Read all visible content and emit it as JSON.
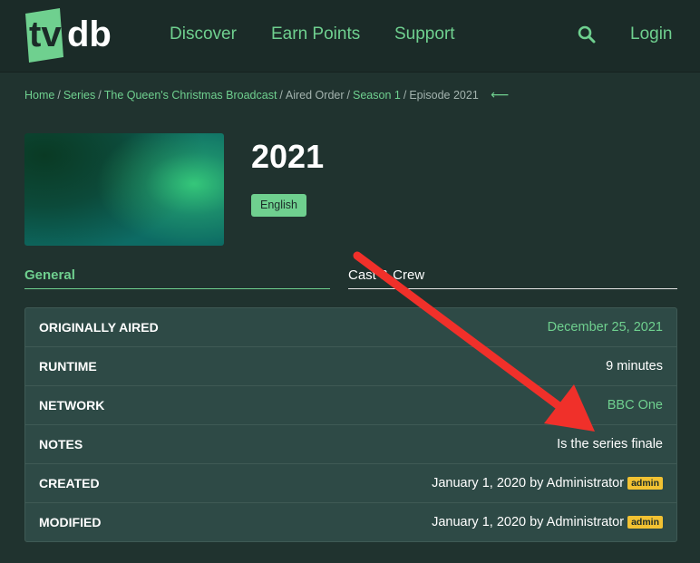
{
  "header": {
    "logo_text": "tvdb",
    "nav": [
      "Discover",
      "Earn Points",
      "Support"
    ],
    "search_icon": "search-icon",
    "login": "Login"
  },
  "breadcrumb": {
    "items": [
      {
        "label": "Home",
        "link": true
      },
      {
        "label": "Series",
        "link": true
      },
      {
        "label": "The Queen's Christmas Broadcast",
        "link": true
      },
      {
        "label": "Aired Order",
        "link": false
      },
      {
        "label": "Season 1",
        "link": true
      },
      {
        "label": "Episode 2021",
        "link": false
      }
    ],
    "separator": "/",
    "back_icon": "back-arrow-icon"
  },
  "episode": {
    "title": "2021",
    "language": "English"
  },
  "tabs": {
    "general": "General",
    "cast": "Cast & Crew"
  },
  "info": [
    {
      "label": "ORIGINALLY AIRED",
      "value": "December 25, 2021",
      "link": true
    },
    {
      "label": "RUNTIME",
      "value": "9 minutes",
      "link": false
    },
    {
      "label": "NETWORK",
      "value": "BBC One",
      "link": true
    },
    {
      "label": "NOTES",
      "value": "Is the series finale",
      "link": false
    },
    {
      "label": "CREATED",
      "value": "January 1, 2020 by Administrator",
      "badge": "admin",
      "link": false
    },
    {
      "label": "MODIFIED",
      "value": "January 1, 2020 by Administrator",
      "badge": "admin",
      "link": false
    }
  ],
  "colors": {
    "accent": "#6fd08f",
    "background": "#20332f",
    "header": "#1b2b28",
    "table": "#2e4a46",
    "admin_badge": "#f2c232",
    "annotation_arrow": "#f0302a"
  }
}
